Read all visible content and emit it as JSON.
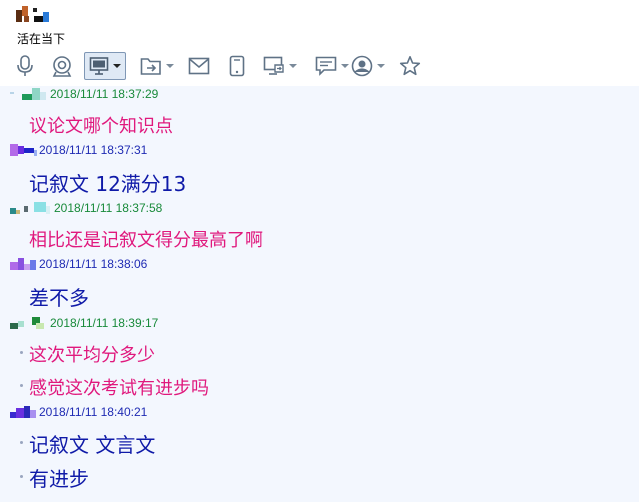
{
  "chat": {
    "name": "活在当下"
  },
  "toolbar": {
    "items": [
      {
        "icon": "microphone-icon"
      },
      {
        "icon": "webcam-icon"
      },
      {
        "icon": "screen-share-icon",
        "has_menu": true,
        "active": true
      },
      {
        "icon": "send-file-icon",
        "has_menu": true
      },
      {
        "icon": "mail-icon"
      },
      {
        "icon": "tablet-icon"
      },
      {
        "icon": "remote-desktop-icon",
        "has_menu": true
      },
      {
        "icon": "chat-note-icon",
        "has_menu": true
      },
      {
        "icon": "app-center-icon",
        "has_menu": true
      },
      {
        "icon": "favorite-star-icon"
      }
    ]
  },
  "colors": {
    "peer_timestamp": "#188a3a",
    "self_timestamp": "#1f2bb3",
    "peer_text": "#e0197d",
    "self_text": "#0f1aa8"
  },
  "messages": [
    {
      "side": "peer",
      "time": "2018/11/11 18:37:29",
      "lines": [
        "议论文哪个知识点"
      ]
    },
    {
      "side": "self",
      "time": "2018/11/11 18:37:31",
      "lines": [
        "记叙文 12满分13"
      ]
    },
    {
      "side": "peer",
      "time": "2018/11/11 18:37:58",
      "lines": [
        "相比还是记叙文得分最高了啊"
      ]
    },
    {
      "side": "self",
      "time": "2018/11/11 18:38:06",
      "lines": [
        "差不多"
      ]
    },
    {
      "side": "peer",
      "time": "2018/11/11 18:39:17",
      "lines": [
        "这次平均分多少",
        "感觉这次考试有进步吗"
      ]
    },
    {
      "side": "self",
      "time": "2018/11/11 18:40:21",
      "lines": [
        "记叙文 文言文",
        "有进步"
      ]
    }
  ]
}
